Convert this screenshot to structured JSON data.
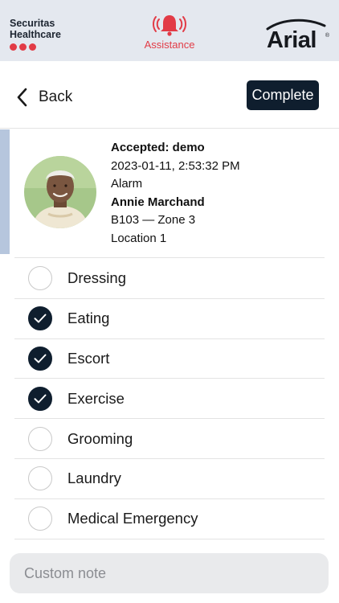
{
  "header": {
    "brand": {
      "line1": "Securitas",
      "line2": "Healthcare"
    },
    "assistance_label": "Assistance",
    "logo_text": "Arial",
    "logo_mark": "®"
  },
  "nav": {
    "back_label": "Back",
    "complete_label": "Complete"
  },
  "alarm": {
    "status": "Accepted: demo",
    "timestamp": "2023-01-11, 2:53:32 PM",
    "type": "Alarm",
    "resident": "Annie Marchand",
    "room": "B103 — Zone 3",
    "location": "Location 1"
  },
  "tasks": [
    {
      "label": "Dressing",
      "checked": false
    },
    {
      "label": "Eating",
      "checked": true
    },
    {
      "label": "Escort",
      "checked": true
    },
    {
      "label": "Exercise",
      "checked": true
    },
    {
      "label": "Grooming",
      "checked": false
    },
    {
      "label": "Laundry",
      "checked": false
    },
    {
      "label": "Medical Emergency",
      "checked": false
    }
  ],
  "note": {
    "placeholder": "Custom note",
    "value": ""
  },
  "colors": {
    "accent_red": "#e23b46",
    "primary_navy": "#0f1e2e",
    "header_bg": "#e4e8ef",
    "card_accent": "#b6c6dd"
  }
}
